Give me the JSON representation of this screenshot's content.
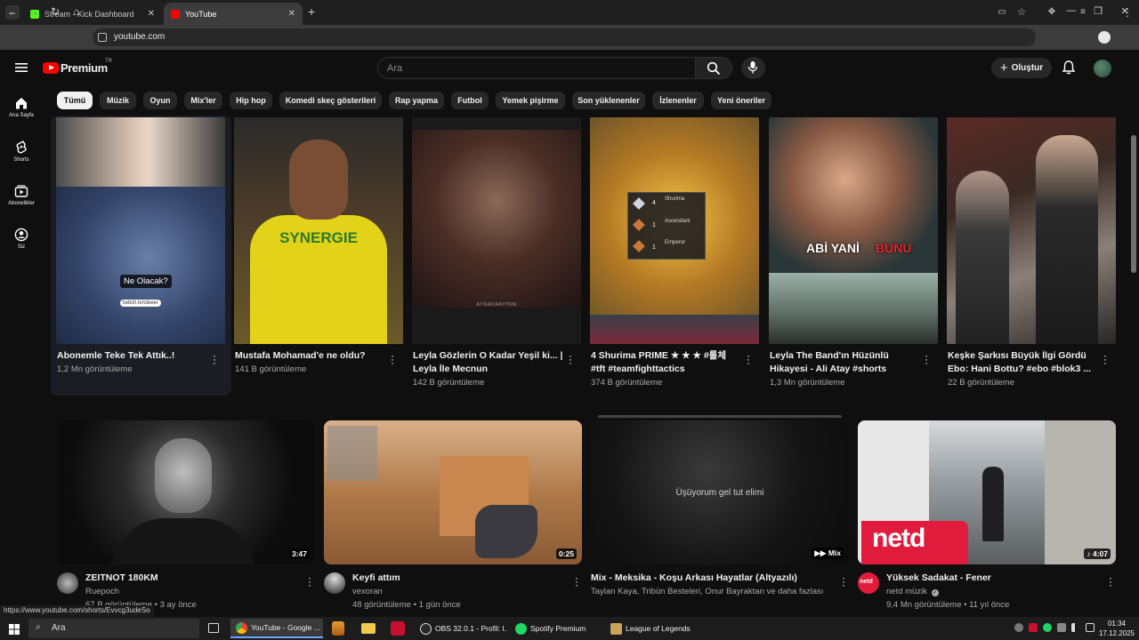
{
  "browser": {
    "tabs": [
      {
        "title": "Stream - Kick Dashboard",
        "favicon_color": "#53fc18"
      },
      {
        "title": "YouTube",
        "favicon_color": "#ff0000"
      }
    ],
    "new_tab_label": "+",
    "url": "youtube.com"
  },
  "header": {
    "logo_text": "Premium",
    "logo_region": "TR",
    "search_placeholder": "Ara",
    "create_label": "Oluştur"
  },
  "left_rail": [
    {
      "label": "Ana Sayfa",
      "icon": "home-icon"
    },
    {
      "label": "Shorts",
      "icon": "shorts-icon"
    },
    {
      "label": "Abonelikler",
      "icon": "subscriptions-icon"
    },
    {
      "label": "Siz",
      "icon": "you-icon"
    }
  ],
  "chips": [
    "Tümü",
    "Müzik",
    "Oyun",
    "Mix'ler",
    "Hip hop",
    "Komedi skeç gösterileri",
    "Rap yapma",
    "Futbol",
    "Yemek pişirme",
    "Son yüklenenler",
    "İzlenenler",
    "Yeni öneriler"
  ],
  "shorts": [
    {
      "title_lines": [
        "Abonemle Teke Tek Attık..!"
      ],
      "views": "1,2 Mn görüntüleme",
      "overlay_text": "Ne Olacak?",
      "overlay_small": "twitch.tv/cleeer"
    },
    {
      "title_lines": [
        "Mustafa Mohamad'e ne oldu?"
      ],
      "views": "141 B görüntüleme",
      "overlay_text": "SYNERGIE"
    },
    {
      "title_lines": [
        "Leyla Gözlerin O Kadar Yeşil ki... |",
        "Leyla İle Mecnun"
      ],
      "views": "142 B görüntüleme",
      "overlay_text": "AYNADAKIYNM"
    },
    {
      "title_lines": [
        "4 Shurima PRIME ★ ★ ★ #롤체",
        "#tft #teamfighttactics"
      ],
      "views": "374 B görüntüleme",
      "overlay_items": [
        "Shurima",
        "Ascendant",
        "Emperor"
      ],
      "overlay_nums": [
        "4",
        "1",
        "1"
      ]
    },
    {
      "title_lines": [
        "Leyla The Band'ın Hüzünlü",
        "Hikayesi - Ali Atay #shorts"
      ],
      "views": "1,3 Mn görüntüleme",
      "overlay_text_a": "ABİ YANİ",
      "overlay_text_b": "BUNU"
    },
    {
      "title_lines": [
        "Keşke Şarkısı Büyük İlgi Gördü",
        "Ebo: Hani Bottu? #ebo #blok3 ..."
      ],
      "views": "22 B görüntüleme"
    }
  ],
  "videos": [
    {
      "title": "ZEITNOT 180KM",
      "channel": "Ruepoch",
      "meta": "67 B görüntüleme • 3 ay önce",
      "duration": "3:47"
    },
    {
      "title": "Keyfi attım",
      "channel": "vexoran",
      "meta": "48 görüntüleme • 1 gün önce",
      "duration": "0:25"
    },
    {
      "title": "Mix - Meksika - Koşu Arkası Hayatlar (Altyazılı)",
      "channel": "Taylan Kaya, Tribün Besteleri, Onur Bayraktan ve daha fazlası",
      "meta": "",
      "duration": "Mix",
      "overlay_text": "Üşüyorum gel tut elimi"
    },
    {
      "title": "Yüksek Sadakat - Fener",
      "channel": "netd müzik",
      "meta": "9,4 Mn görüntüleme • 11 yıl önce",
      "duration": "4:07",
      "overlay_text": "netd",
      "channel_avatar_text": "netd"
    }
  ],
  "status_url": "https://www.youtube.com/shorts/Evvcg3udeSo",
  "taskbar": {
    "search_label": "Ara",
    "apps": [
      "YouTube - Google ...",
      "OBS 32.0.1 - Profil: l...",
      "Spotify Premium",
      "League of Legends"
    ],
    "time": "01:34",
    "date": "17.12.2025"
  }
}
